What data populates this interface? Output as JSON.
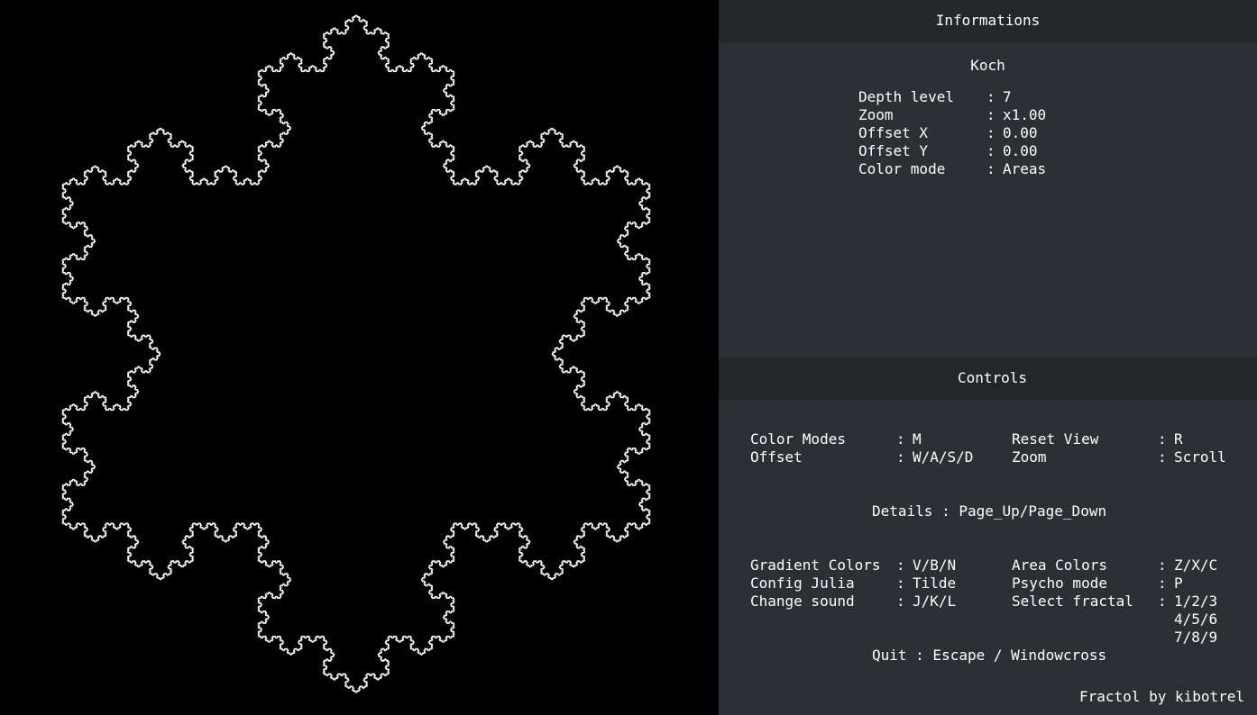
{
  "render": {
    "fractal": "Koch",
    "background_color": "#000000",
    "line_color": "#ffffff"
  },
  "informations": {
    "title": "Informations",
    "fractal_name": "Koch",
    "rows": [
      {
        "label": "Depth level",
        "value": "7"
      },
      {
        "label": "Zoom",
        "value": "x1.00"
      },
      {
        "label": "Offset X",
        "value": "0.00"
      },
      {
        "label": "Offset Y",
        "value": "0.00"
      },
      {
        "label": "Color mode",
        "value": "Areas"
      }
    ]
  },
  "controls": {
    "title": "Controls",
    "group1_left": [
      {
        "label": "Color Modes",
        "key": "M"
      },
      {
        "label": "Offset",
        "key": "W/A/S/D"
      }
    ],
    "group1_right": [
      {
        "label": "Reset View",
        "key": "R"
      },
      {
        "label": "Zoom",
        "key": "Scroll"
      }
    ],
    "details": "Details : Page_Up/Page_Down",
    "group2_left": [
      {
        "label": "Gradient Colors",
        "key": "V/B/N"
      },
      {
        "label": "Config Julia",
        "key": "Tilde"
      },
      {
        "label": "Change sound",
        "key": "J/K/L"
      }
    ],
    "group2_right": [
      {
        "label": "Area Colors",
        "key": "Z/X/C"
      },
      {
        "label": "Psycho mode",
        "key": "P"
      },
      {
        "label": "Select fractal",
        "key": "1/2/3"
      }
    ],
    "select_fractal_extra": [
      "4/5/6",
      "7/8/9"
    ],
    "quit": "Quit : Escape / Windowcross"
  },
  "footer": {
    "credit": "Fractol by kibotrel"
  },
  "colors": {
    "panel_bg": "#2c2f33",
    "bar_bg": "#23272a",
    "text": "#ffffff"
  }
}
